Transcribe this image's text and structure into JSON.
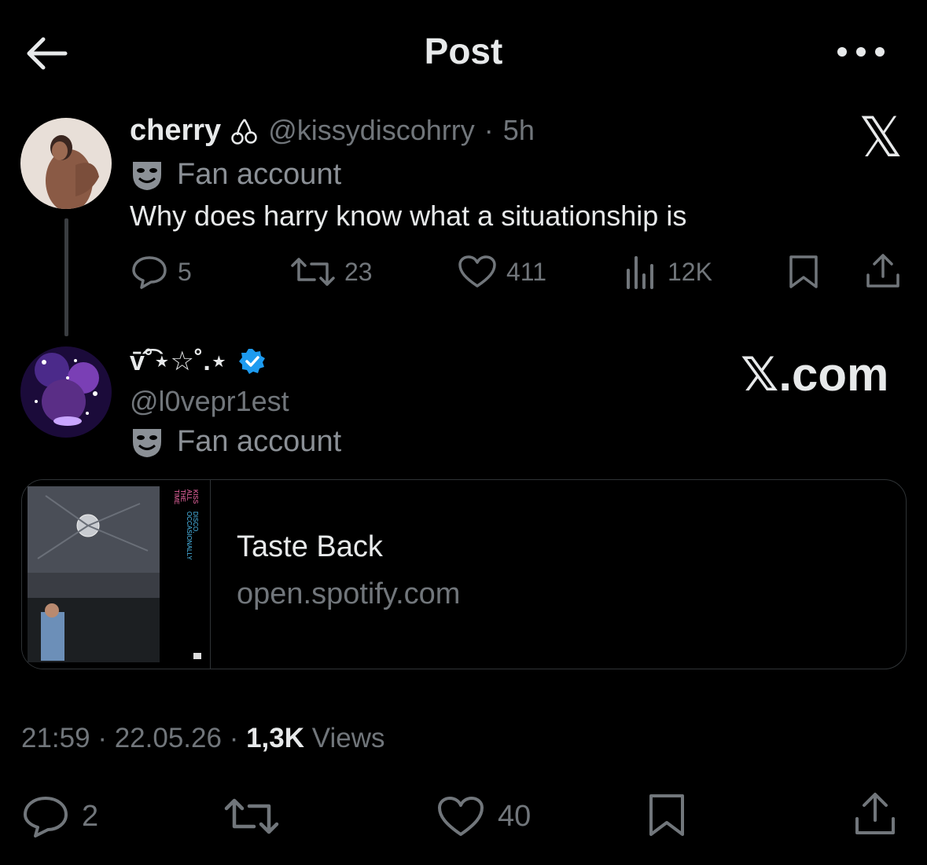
{
  "header": {
    "title": "Post"
  },
  "quoted_post": {
    "name": "cherry",
    "handle": "@kissydiscohrry",
    "separator": "·",
    "time": "5h",
    "label": "Fan account",
    "text": "Why does harry know what a situationship is",
    "replies": "5",
    "reposts": "23",
    "likes": "411",
    "views": "12K"
  },
  "watermark_top": "𝕏",
  "watermark_mid": "𝕏.com",
  "reply_post": {
    "name": "v̄͡˚⋆☆˚.⋆",
    "handle": "@l0vepr1est",
    "label": "Fan account"
  },
  "link_card": {
    "title": "Taste Back",
    "domain": "open.spotify.com",
    "cover_text": [
      "KISS",
      "ALL",
      "THE",
      "TIME",
      "DISCO,",
      "OCCASIONALLY"
    ]
  },
  "meta": {
    "time": "21:59",
    "sep1": "·",
    "date": "22.05.26",
    "sep2": "·",
    "views_count": "1,3K",
    "views_label": "Views"
  },
  "bottom_actions": {
    "replies": "2",
    "likes": "40"
  },
  "colors": {
    "background": "#000000",
    "text": "#e7e9ea",
    "muted": "#71767b",
    "verified": "#1d9bf0",
    "border": "#2f3336"
  }
}
